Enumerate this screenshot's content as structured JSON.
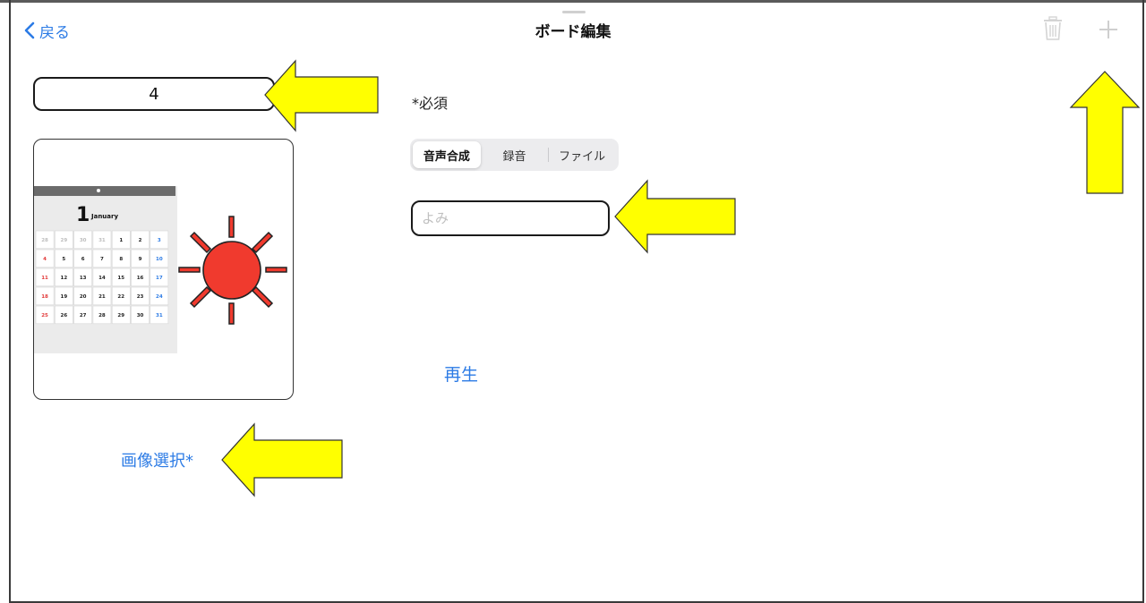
{
  "nav": {
    "back_label": "戻る",
    "title": "ボード編集",
    "trash_icon": "trash-icon",
    "plus_icon": "plus-icon"
  },
  "form": {
    "name_value": "4",
    "select_image_label": "画像選択*",
    "required_label": "*必須",
    "segments": [
      {
        "label": "音声合成",
        "selected": true
      },
      {
        "label": "録音",
        "selected": false
      },
      {
        "label": "ファイル",
        "selected": false
      }
    ],
    "reading_placeholder": "よみ",
    "reading_value": "",
    "play_label": "再生"
  },
  "image": {
    "calendar": {
      "day": "1",
      "month": "January",
      "weeks": [
        [
          "28",
          "29",
          "30",
          "31",
          "1",
          "2",
          "3"
        ],
        [
          "4",
          "5",
          "6",
          "7",
          "8",
          "9",
          "10"
        ],
        [
          "11",
          "12",
          "13",
          "14",
          "15",
          "16",
          "17"
        ],
        [
          "18",
          "19",
          "20",
          "21",
          "22",
          "23",
          "24"
        ],
        [
          "25",
          "26",
          "27",
          "28",
          "29",
          "30",
          "31"
        ]
      ]
    },
    "sun_color": "#f03a2e"
  },
  "annotations": {
    "arrow_color": "#ffff00"
  },
  "colors": {
    "accent": "#2c7be5"
  }
}
